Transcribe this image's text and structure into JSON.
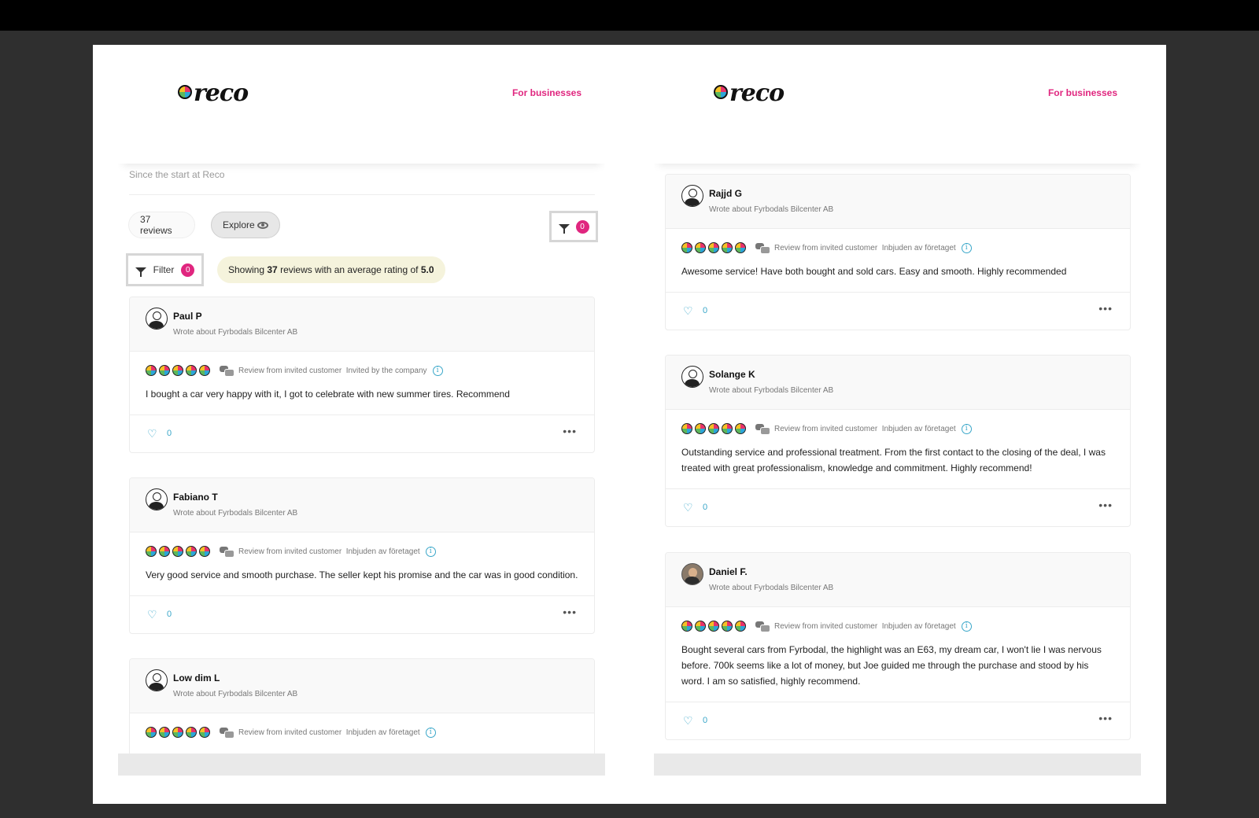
{
  "brand": {
    "logo_text": "reco",
    "for_businesses": "For businesses"
  },
  "left": {
    "since": "Since the start at Reco",
    "reviews_count": "37 reviews",
    "explore": "Explore",
    "filter_badge": "0",
    "filter_label": "Filter",
    "filter_badge2": "0",
    "showing": {
      "prefix": "Showing ",
      "count": "37",
      "middle": " reviews with an average rating of ",
      "rating": "5.0"
    },
    "reviews": [
      {
        "name": "Paul P",
        "wrote": "Wrote about Fyrbodals Bilcenter AB",
        "meta": "Review from invited customer  Invited by the company",
        "text": "I bought a car very happy with it, I got to celebrate with new summer tires. Recommend",
        "likes": "0"
      },
      {
        "name": "Fabiano T",
        "wrote": "Wrote about Fyrbodals Bilcenter AB",
        "meta": "Review from invited customer  Inbjuden av företaget",
        "text": "Very good service and smooth purchase. The seller kept his promise and the car was in good condition.",
        "likes": "0"
      },
      {
        "name": "Low dim L",
        "wrote": "Wrote about Fyrbodals Bilcenter AB",
        "meta": "Review from invited customer  Inbjuden av företaget"
      }
    ]
  },
  "right": {
    "reviews": [
      {
        "name": "Rajjd G",
        "wrote": "Wrote about Fyrbodals Bilcenter AB",
        "meta": "Review from invited customer  Inbjuden av företaget",
        "text": "Awesome service! Have both bought and sold cars. Easy and smooth. Highly recommended",
        "likes": "0"
      },
      {
        "name": "Solange K",
        "wrote": "Wrote about Fyrbodals Bilcenter AB",
        "meta": "Review from invited customer  Inbjuden av företaget",
        "text": "Outstanding service and professional treatment. From the first contact to the closing of the deal, I was treated with great professionalism, knowledge and commitment. Highly recommend!",
        "likes": "0"
      },
      {
        "name": "Daniel F.",
        "wrote": "Wrote about Fyrbodals Bilcenter AB",
        "meta": "Review from invited customer  Inbjuden av företaget",
        "text": "Bought several cars from Fyrbodal, the highlight was an E63, my dream car, I won't lie I was nervous before. 700k seems like a lot of money, but Joe guided me through the purchase and stood by his word. I am so satisfied, highly recommend.",
        "likes": "0"
      }
    ]
  },
  "rating_stars": 5,
  "colors": {
    "accent": "#e0267f",
    "link": "#3aa7c9",
    "highlight": "#f5f3dc"
  },
  "icons": {
    "filter": "filter-icon",
    "explore": "eye-icon",
    "like": "heart-icon",
    "more": "more-icon",
    "info": "info-icon",
    "review_type": "chat-icon"
  }
}
